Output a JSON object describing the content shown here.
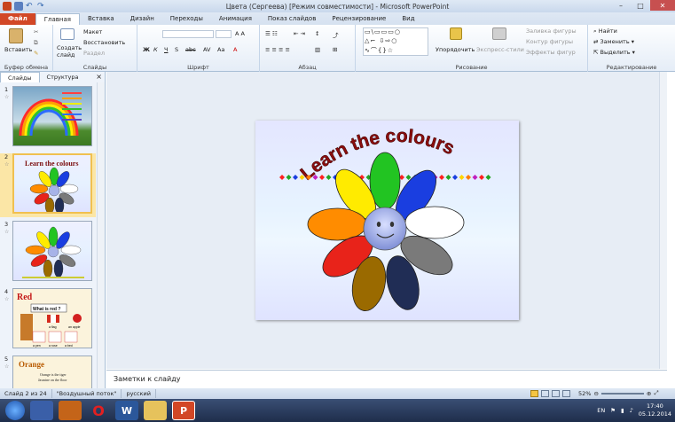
{
  "window": {
    "title": "Цвета (Сергеева) [Режим совместимости] - Microsoft PowerPoint"
  },
  "tabs": [
    "Файл",
    "Главная",
    "Вставка",
    "Дизайн",
    "Переходы",
    "Анимация",
    "Показ слайдов",
    "Рецензирование",
    "Вид"
  ],
  "ribbon": {
    "clipboard": {
      "label": "Буфер обмена",
      "paste": "Вставить"
    },
    "slides": {
      "label": "Слайды",
      "new_slide": "Создать слайд",
      "layout": "Макет",
      "reset": "Восстановить",
      "section": "Раздел"
    },
    "font": {
      "label": "Шрифт"
    },
    "paragraph": {
      "label": "Абзац"
    },
    "drawing": {
      "label": "Рисование",
      "arrange": "Упорядочить",
      "quick_styles": "Экспресс-стили",
      "fill": "Заливка фигуры",
      "outline": "Контур фигуры",
      "effects": "Эффекты фигур"
    },
    "editing": {
      "label": "Редактирование",
      "find": "Найти",
      "replace": "Заменить",
      "select": "Выделить"
    }
  },
  "panel": {
    "tab_slides": "Слайды",
    "tab_outline": "Структура",
    "close": "×"
  },
  "thumbnails": [
    {
      "num": "1",
      "title": ""
    },
    {
      "num": "2",
      "title": "Learn the colours"
    },
    {
      "num": "3",
      "title": ""
    },
    {
      "num": "4",
      "title": "Red",
      "subtitle": "What is red ?",
      "captions": [
        "a flag",
        "an apple",
        "a pen",
        "a rose",
        "a bed"
      ]
    },
    {
      "num": "5",
      "title": "Orange",
      "subtitle": "Orange is the tiger",
      "subtitle2": "Jasmine on the floor"
    }
  ],
  "slide": {
    "title": "Learn the colours"
  },
  "notes": {
    "placeholder": "Заметки к слайду"
  },
  "status": {
    "slide_info": "Слайд 2 из 24",
    "theme": "\"Воздушный поток\"",
    "language": "русский",
    "zoom": "52%"
  },
  "taskbar": {
    "lang": "EN",
    "time": "17:40",
    "date": "05.12.2014"
  },
  "colors": {
    "accent": "#2b579a",
    "file_tab": "#d24726",
    "petals": [
      "#ffeb00",
      "#22c422",
      "#1a3ee0",
      "#ff8c00",
      "#ffffff",
      "#e8231a",
      "#7a7a7a",
      "#9a6a00",
      "#202d55"
    ]
  }
}
